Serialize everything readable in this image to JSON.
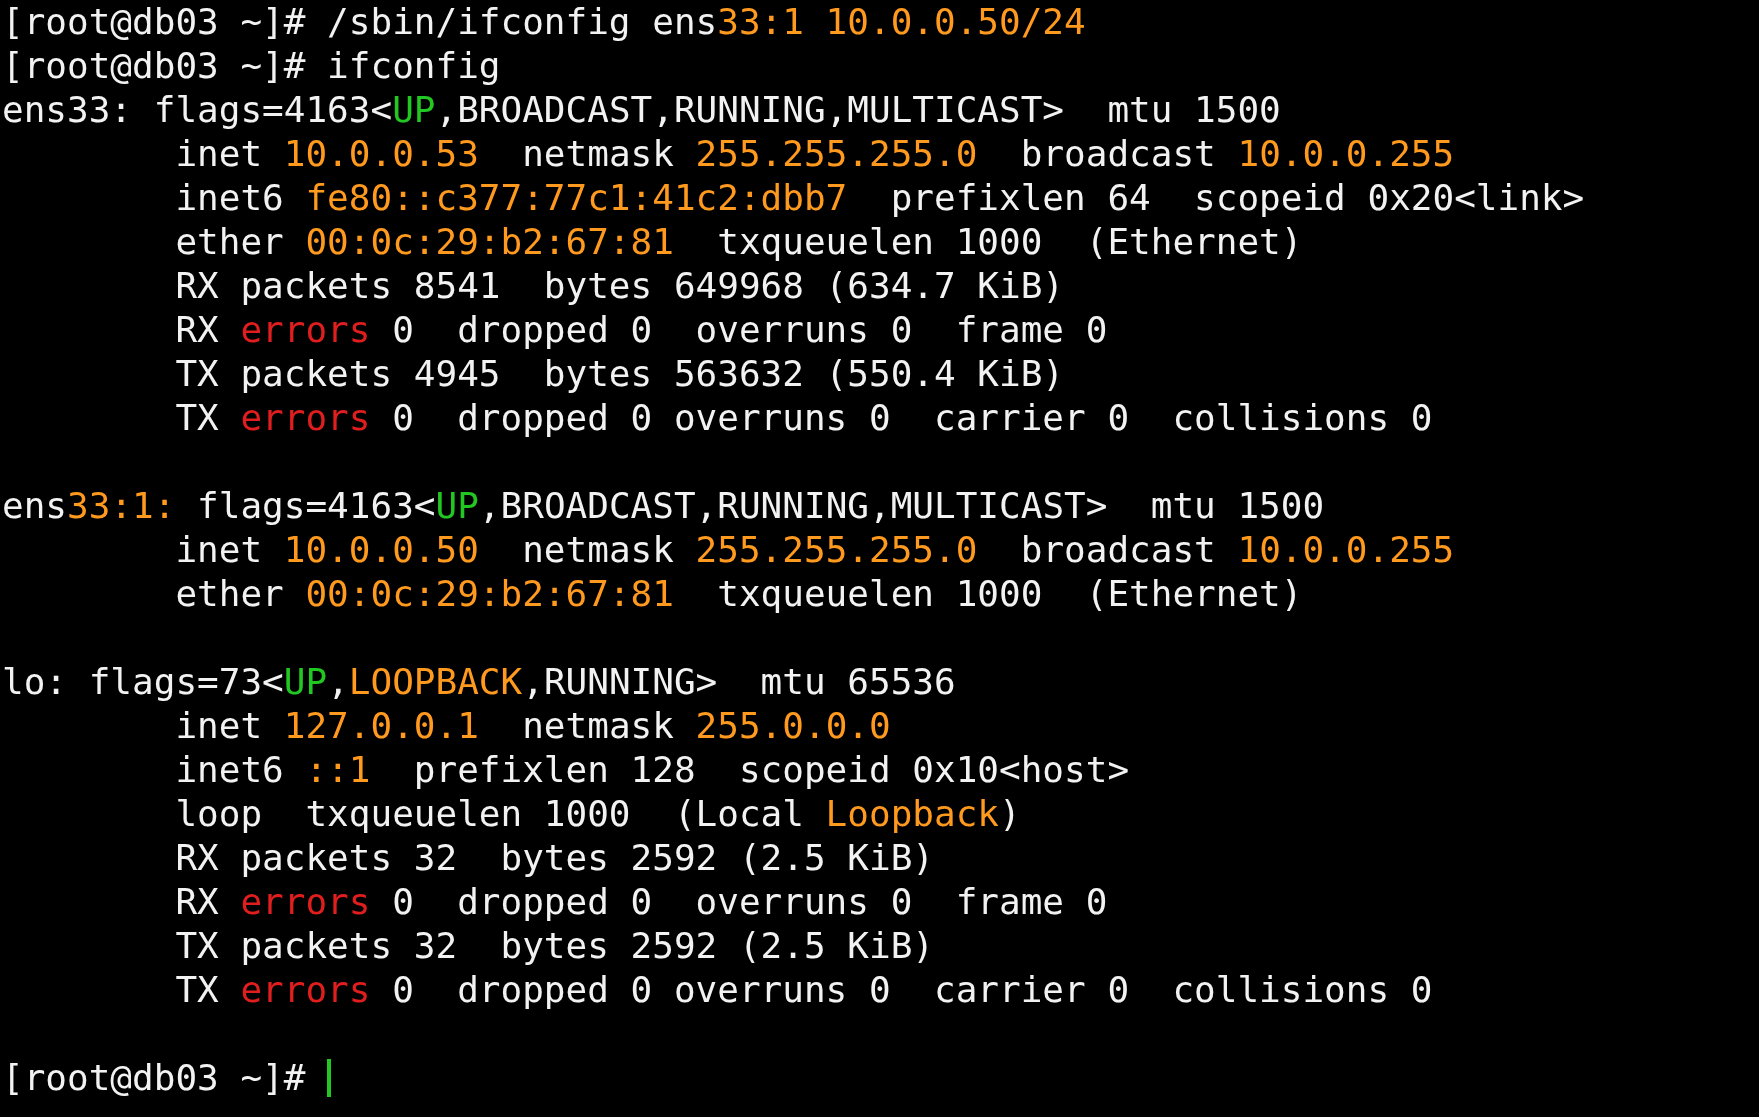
{
  "terminal": {
    "lines": [
      {
        "kind": "text",
        "segments": [
          {
            "text": "[root@db03 ~]# /sbin/ifconfig ens"
          },
          {
            "text": "33:1 10.0.0.50/24",
            "color": "#ff9a1e"
          }
        ]
      },
      {
        "kind": "text",
        "segments": [
          {
            "text": "[root@db03 ~]# ifconfig"
          }
        ]
      },
      {
        "kind": "text",
        "segments": [
          {
            "text": "ens33: flags=4163<"
          },
          {
            "text": "UP",
            "color": "#22c822"
          },
          {
            "text": ",BROADCAST,RUNNING,MULTICAST>  mtu 1500"
          }
        ]
      },
      {
        "kind": "text",
        "segments": [
          {
            "text": "        inet "
          },
          {
            "text": "10.0.0.53",
            "color": "#ff9a1e"
          },
          {
            "text": "  netmask "
          },
          {
            "text": "255.255.255.0",
            "color": "#ff9a1e"
          },
          {
            "text": "  broadcast "
          },
          {
            "text": "10.0.0.255",
            "color": "#ff9a1e"
          }
        ]
      },
      {
        "kind": "text",
        "segments": [
          {
            "text": "        inet6 "
          },
          {
            "text": "fe80::c377:77c1:41c2:dbb7",
            "color": "#ff9a1e"
          },
          {
            "text": "  prefixlen 64  scopeid 0x20<link>"
          }
        ]
      },
      {
        "kind": "text",
        "segments": [
          {
            "text": "        ether "
          },
          {
            "text": "00:0c:29:b2:67:81",
            "color": "#ff9a1e"
          },
          {
            "text": "  txqueuelen 1000  (Ethernet)"
          }
        ]
      },
      {
        "kind": "text",
        "segments": [
          {
            "text": "        RX packets 8541  bytes 649968 (634.7 KiB)"
          }
        ]
      },
      {
        "kind": "text",
        "segments": [
          {
            "text": "        RX "
          },
          {
            "text": "errors",
            "color": "#e01e1e"
          },
          {
            "text": " 0  dropped 0  overruns 0  frame 0"
          }
        ]
      },
      {
        "kind": "text",
        "segments": [
          {
            "text": "        TX packets 4945  bytes 563632 (550.4 KiB)"
          }
        ]
      },
      {
        "kind": "text",
        "segments": [
          {
            "text": "        TX "
          },
          {
            "text": "errors",
            "color": "#e01e1e"
          },
          {
            "text": " 0  dropped 0 overruns 0  carrier 0  collisions 0"
          }
        ]
      },
      {
        "kind": "blank"
      },
      {
        "kind": "text",
        "segments": [
          {
            "text": "ens"
          },
          {
            "text": "33:1:",
            "color": "#ff9a1e"
          },
          {
            "text": " flags=4163<"
          },
          {
            "text": "UP",
            "color": "#22c822"
          },
          {
            "text": ",BROADCAST,RUNNING,MULTICAST>  mtu 1500"
          }
        ]
      },
      {
        "kind": "text",
        "segments": [
          {
            "text": "        inet "
          },
          {
            "text": "10.0.0.50",
            "color": "#ff9a1e"
          },
          {
            "text": "  netmask "
          },
          {
            "text": "255.255.255.0",
            "color": "#ff9a1e"
          },
          {
            "text": "  broadcast "
          },
          {
            "text": "10.0.0.255",
            "color": "#ff9a1e"
          }
        ]
      },
      {
        "kind": "text",
        "segments": [
          {
            "text": "        ether "
          },
          {
            "text": "00:0c:29:b2:67:81",
            "color": "#ff9a1e"
          },
          {
            "text": "  txqueuelen 1000  (Ethernet)"
          }
        ]
      },
      {
        "kind": "blank"
      },
      {
        "kind": "text",
        "segments": [
          {
            "text": "lo: flags=73<"
          },
          {
            "text": "UP",
            "color": "#22c822"
          },
          {
            "text": ","
          },
          {
            "text": "LOOPBACK",
            "color": "#ff9a1e"
          },
          {
            "text": ",RUNNING>  mtu 65536"
          }
        ]
      },
      {
        "kind": "text",
        "segments": [
          {
            "text": "        inet "
          },
          {
            "text": "127.0.0.1",
            "color": "#ff9a1e"
          },
          {
            "text": "  netmask "
          },
          {
            "text": "255.0.0.0",
            "color": "#ff9a1e"
          }
        ]
      },
      {
        "kind": "text",
        "segments": [
          {
            "text": "        inet6 "
          },
          {
            "text": "::1",
            "color": "#ff9a1e"
          },
          {
            "text": "  prefixlen 128  scopeid 0x10<host>"
          }
        ]
      },
      {
        "kind": "text",
        "segments": [
          {
            "text": "        loop  txqueuelen 1000  (Local "
          },
          {
            "text": "Loopback",
            "color": "#ff9a1e"
          },
          {
            "text": ")"
          }
        ]
      },
      {
        "kind": "text",
        "segments": [
          {
            "text": "        RX packets 32  bytes 2592 (2.5 KiB)"
          }
        ]
      },
      {
        "kind": "text",
        "segments": [
          {
            "text": "        RX "
          },
          {
            "text": "errors",
            "color": "#e01e1e"
          },
          {
            "text": " 0  dropped 0  overruns 0  frame 0"
          }
        ]
      },
      {
        "kind": "text",
        "segments": [
          {
            "text": "        TX packets 32  bytes 2592 (2.5 KiB)"
          }
        ]
      },
      {
        "kind": "text",
        "segments": [
          {
            "text": "        TX "
          },
          {
            "text": "errors",
            "color": "#e01e1e"
          },
          {
            "text": " 0  dropped 0 overruns 0  carrier 0  collisions 0"
          }
        ]
      },
      {
        "kind": "blank"
      },
      {
        "kind": "prompt",
        "segments": [
          {
            "text": "[root@db03 ~]# "
          }
        ],
        "cursor": true
      }
    ]
  }
}
